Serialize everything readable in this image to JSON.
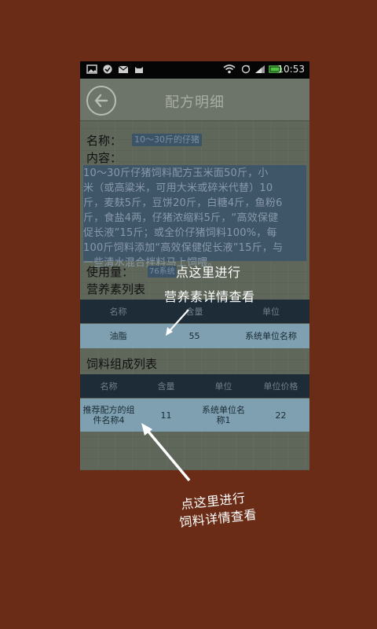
{
  "status_bar": {
    "time": "10:53",
    "left_icons": [
      "image-icon",
      "check-circle-icon",
      "mail-icon",
      "cat-icon"
    ],
    "right_icons": [
      "wifi-icon",
      "sync-icon",
      "signal-icon",
      "battery-icon"
    ]
  },
  "header": {
    "title": "配方明细",
    "back_icon": "back-arrow-icon"
  },
  "detail": {
    "name_label": "名称：",
    "name_value": "10～30斤的仔猪",
    "content_label": "内容：",
    "content_lines": [
      "10～30斤仔猪饲料配方玉米面50斤，小",
      "米（或高粱米，可用大米或碎米代替）10",
      "斤，麦麸5斤，豆饼20斤，白糖4斤，鱼粉6",
      "斤，食盐4两，仔猪浓缩料5斤，“高效保健",
      "促长液”15斤；或全价仔猪饲料100%，每",
      "100斤饲料添加“高效保健促长液”15斤，与",
      "一些清水混合拌料马上饲喂。"
    ],
    "usage_label": "使用量：",
    "usage_value": "76系统"
  },
  "nutrient_section": {
    "title": "营养素列表",
    "columns": [
      "名称",
      "含量",
      "单位"
    ],
    "rows": [
      [
        "油脂",
        "55",
        "系统单位名称"
      ]
    ]
  },
  "feed_section": {
    "title": "饲料组成列表",
    "columns": [
      "名称",
      "含量",
      "单位",
      "单位价格"
    ],
    "rows": [
      [
        "推荐配方的组件名称4",
        "11",
        "系统单位名称1",
        "22"
      ]
    ]
  },
  "annotations": {
    "note1_line1": "点这里进行",
    "note1_line2": "营养素详情查看",
    "note2_line1": "点这里进行",
    "note2_line2": "饲料详情查看"
  },
  "colors": {
    "background": "#6a2c16",
    "table_header": "#1e2c38",
    "table_row": "#7ea0b0",
    "highlight": "#3f5669"
  }
}
